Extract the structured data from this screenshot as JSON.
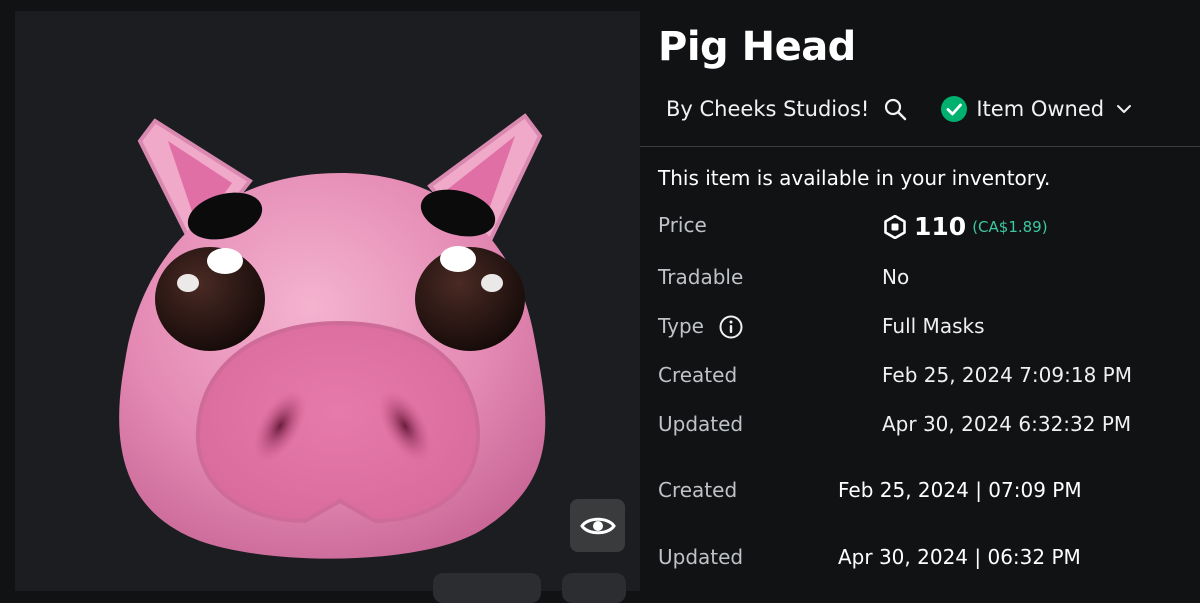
{
  "item": {
    "title": "Pig Head",
    "creator": "By Cheeks Studios!",
    "owned_label": "Item Owned",
    "notice": "This item is available in your inventory."
  },
  "details": {
    "price_label": "Price",
    "price_amount": "110",
    "price_converted": "(CA$1.89)",
    "tradable_label": "Tradable",
    "tradable_value": "No",
    "type_label": "Type",
    "type_value": "Full Masks",
    "created_label": "Created",
    "created_value": "Feb 25, 2024 7:09:18 PM",
    "updated_label": "Updated",
    "updated_value": "Apr 30, 2024 6:32:32 PM"
  },
  "extra": {
    "created_label": "Created",
    "created_value": "Feb 25, 2024 | 07:09 PM",
    "updated_label": "Updated",
    "updated_value": "Apr 30, 2024 | 06:32 PM"
  },
  "colors": {
    "background": "#111214",
    "preview_bg": "#1c1d21",
    "owned_check": "#00b06f",
    "robux_converted": "#3cc9a0"
  },
  "icons": {
    "search": "search-icon",
    "owned": "check-circle-icon",
    "dropdown": "chevron-down-icon",
    "robux": "robux-icon",
    "info": "info-icon",
    "view": "eye-icon"
  }
}
